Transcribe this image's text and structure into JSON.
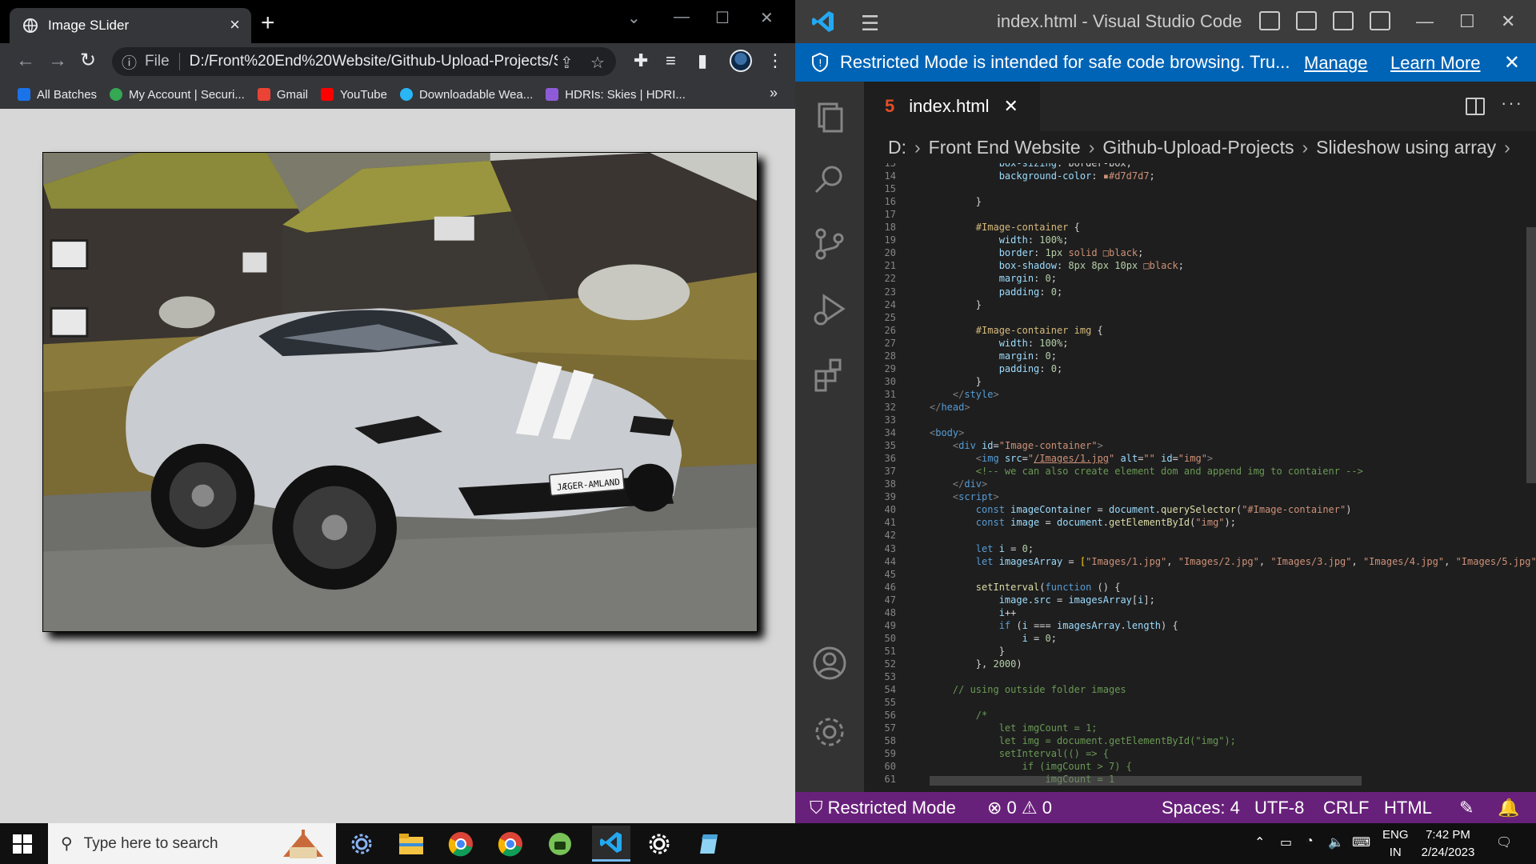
{
  "chrome": {
    "tab_title": "Image SLider",
    "url_scheme_label": "File",
    "url": "D:/Front%20End%20Website/Github-Upload-Projects/Slid...",
    "bookmarks": [
      {
        "label": "All Batches",
        "color": "#1a73e8"
      },
      {
        "label": "My Account | Securi...",
        "color": "#34a853"
      },
      {
        "label": "Gmail",
        "color": "#ea4335"
      },
      {
        "label": "YouTube",
        "color": "#ff0000"
      },
      {
        "label": "Downloadable Wea...",
        "color": "#29b6f6"
      },
      {
        "label": "HDRIs: Skies | HDRI...",
        "color": "#8e5bd8"
      }
    ],
    "image_alt": "",
    "plate_text": "JÆGER-AMLAND"
  },
  "vscode": {
    "window_title": "index.html - Visual Studio Code",
    "banner": {
      "message": "Restricted Mode is intended for safe code browsing. Tru...",
      "manage": "Manage",
      "learn_more": "Learn More"
    },
    "tab": "index.html",
    "breadcrumb": [
      "D:",
      "Front End Website",
      "Github-Upload-Projects",
      "Slideshow using array"
    ],
    "code_lines": [
      {
        "n": "13",
        "html": "            <span class=\"v\">box-sizing</span>: border-box;"
      },
      {
        "n": "14",
        "html": "            <span class=\"v\">background-color</span>: <span class=\"s\">▪#d7d7d7</span>;"
      },
      {
        "n": "15",
        "html": ""
      },
      {
        "n": "16",
        "html": "        }"
      },
      {
        "n": "17",
        "html": ""
      },
      {
        "n": "18",
        "html": "        <span class=\"p\">#Image-container</span> {"
      },
      {
        "n": "19",
        "html": "            <span class=\"v\">width</span>: <span class=\"n\">100%</span>;"
      },
      {
        "n": "20",
        "html": "            <span class=\"v\">border</span>: <span class=\"n\">1px</span> <span class=\"s\">solid</span> <span class=\"s\">□black</span>;"
      },
      {
        "n": "21",
        "html": "            <span class=\"v\">box-shadow</span>: <span class=\"n\">8px</span> <span class=\"n\">8px</span> <span class=\"n\">10px</span> <span class=\"s\">□black</span>;"
      },
      {
        "n": "22",
        "html": "            <span class=\"v\">margin</span>: <span class=\"n\">0</span>;"
      },
      {
        "n": "23",
        "html": "            <span class=\"v\">padding</span>: <span class=\"n\">0</span>;"
      },
      {
        "n": "24",
        "html": "        }"
      },
      {
        "n": "25",
        "html": ""
      },
      {
        "n": "26",
        "html": "        <span class=\"p\">#Image-container</span> <span class=\"p\">img</span> {"
      },
      {
        "n": "27",
        "html": "            <span class=\"v\">width</span>: <span class=\"n\">100%</span>;"
      },
      {
        "n": "28",
        "html": "            <span class=\"v\">margin</span>: <span class=\"n\">0</span>;"
      },
      {
        "n": "29",
        "html": "            <span class=\"v\">padding</span>: <span class=\"n\">0</span>;"
      },
      {
        "n": "30",
        "html": "        }"
      },
      {
        "n": "31",
        "html": "    <span class=\"tg\">&lt;/</span><span class=\"t\">style</span><span class=\"tg\">&gt;</span>"
      },
      {
        "n": "32",
        "html": "<span class=\"tg\">&lt;/</span><span class=\"t\">head</span><span class=\"tg\">&gt;</span>"
      },
      {
        "n": "33",
        "html": ""
      },
      {
        "n": "34",
        "html": "<span class=\"tg\">&lt;</span><span class=\"t\">body</span><span class=\"tg\">&gt;</span>"
      },
      {
        "n": "35",
        "html": "    <span class=\"tg\">&lt;</span><span class=\"t\">div</span> <span class=\"v\">id</span>=<span class=\"s\">\"Image-container\"</span><span class=\"tg\">&gt;</span>"
      },
      {
        "n": "36",
        "html": "        <span class=\"tg\">&lt;</span><span class=\"t\">img</span> <span class=\"v\">src</span>=<span class=\"s\">\"<u>/Images/1.jpg</u>\"</span> <span class=\"v\">alt</span>=<span class=\"s\">\"\"</span> <span class=\"v\">id</span>=<span class=\"s\">\"img\"</span><span class=\"tg\">&gt;</span>"
      },
      {
        "n": "37",
        "html": "        <span class=\"c\">&lt;!-- we can also create element dom and append img to contaienr --&gt;</span>"
      },
      {
        "n": "38",
        "html": "    <span class=\"tg\">&lt;/</span><span class=\"t\">div</span><span class=\"tg\">&gt;</span>"
      },
      {
        "n": "39",
        "html": "    <span class=\"tg\">&lt;</span><span class=\"t\">script</span><span class=\"tg\">&gt;</span>"
      },
      {
        "n": "40",
        "html": "        <span class=\"k\">const</span> <span class=\"v\">imageContainer</span> = <span class=\"v\">document</span>.<span class=\"f\">querySelector</span>(<span class=\"s\">\"#Image-container\"</span>)"
      },
      {
        "n": "41",
        "html": "        <span class=\"k\">const</span> <span class=\"v\">image</span> = <span class=\"v\">document</span>.<span class=\"f\">getElementById</span>(<span class=\"s\">\"img\"</span>);"
      },
      {
        "n": "42",
        "html": ""
      },
      {
        "n": "43",
        "html": "        <span class=\"k\">let</span> <span class=\"v\">i</span> = <span class=\"n\">0</span>;"
      },
      {
        "n": "44",
        "html": "        <span class=\"k\">let</span> <span class=\"v\">imagesArray</span> = <span class=\"y\">[</span><span class=\"s\">\"Images/1.jpg\"</span>, <span class=\"s\">\"Images/2.jpg\"</span>, <span class=\"s\">\"Images/3.jpg\"</span>, <span class=\"s\">\"Images/4.jpg\"</span>, <span class=\"s\">\"Images/5.jpg\"</span>, <span class=\"s\">\"I</span>"
      },
      {
        "n": "45",
        "html": ""
      },
      {
        "n": "46",
        "html": "        <span class=\"f\">setInterval</span>(<span class=\"k\">function</span> () {"
      },
      {
        "n": "47",
        "html": "            <span class=\"v\">image</span>.<span class=\"v\">src</span> = <span class=\"v\">imagesArray</span>[<span class=\"v\">i</span>];"
      },
      {
        "n": "48",
        "html": "            <span class=\"v\">i</span>++"
      },
      {
        "n": "49",
        "html": "            <span class=\"k\">if</span> (<span class=\"v\">i</span> === <span class=\"v\">imagesArray</span>.<span class=\"v\">length</span>) {"
      },
      {
        "n": "50",
        "html": "                <span class=\"v\">i</span> = <span class=\"n\">0</span>;"
      },
      {
        "n": "51",
        "html": "            }"
      },
      {
        "n": "52",
        "html": "        }, <span class=\"n\">2000</span>)"
      },
      {
        "n": "53",
        "html": ""
      },
      {
        "n": "54",
        "html": "    <span class=\"c\">// using outside folder images</span>"
      },
      {
        "n": "55",
        "html": ""
      },
      {
        "n": "56",
        "html": "        <span class=\"c\">/*</span>"
      },
      {
        "n": "57",
        "html": "<span class=\"c\">            let imgCount = 1;</span>"
      },
      {
        "n": "58",
        "html": "<span class=\"c\">            let img = document.getElementById(\"img\");</span>"
      },
      {
        "n": "59",
        "html": "<span class=\"c\">            setInterval(() =&gt; {</span>"
      },
      {
        "n": "60",
        "html": "<span class=\"c\">                if (imgCount &gt; 7) {</span>"
      },
      {
        "n": "61",
        "html": "<span class=\"c\">                    imgCount = 1</span>"
      }
    ],
    "status": {
      "restricted": "Restricted Mode",
      "errors": "0",
      "warnings": "0",
      "spaces": "Spaces: 4",
      "encoding": "UTF-8",
      "eol": "CRLF",
      "language": "HTML"
    },
    "colors": {
      "statusbar": "#68217a",
      "banner": "#0064b6"
    }
  },
  "taskbar": {
    "search_placeholder": "Type here to search",
    "lang_1": "ENG",
    "lang_2": "IN",
    "time": "7:42 PM",
    "date": "2/24/2023"
  }
}
